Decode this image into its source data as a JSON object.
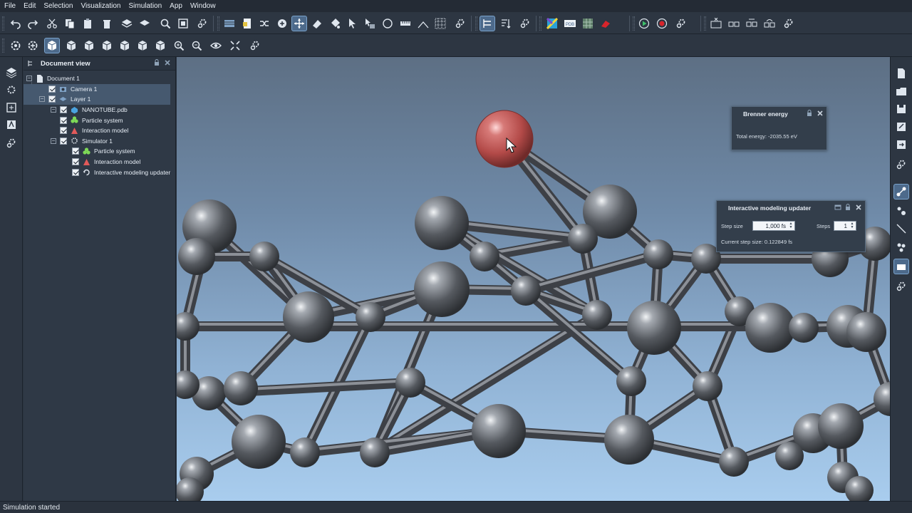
{
  "menubar": {
    "items": [
      "File",
      "Edit",
      "Selection",
      "Visualization",
      "Simulation",
      "App",
      "Window"
    ]
  },
  "toolbar_icons_row1": [
    "undo-icon",
    "redo-icon",
    "cut-icon",
    "copy-icon",
    "paste-icon",
    "delete-icon",
    "layer-icon",
    "layer-stack-icon",
    "zoom-icon",
    "fit-view-icon",
    "settings-icon",
    "grid-icon",
    "sheet-icon",
    "shuffle-icon",
    "add-atom-icon",
    "move-icon",
    "eraser-icon",
    "paint-icon",
    "select-icon",
    "select-box-icon",
    "lasso-icon",
    "ruler-icon",
    "angle-icon",
    "mesh-icon",
    "settings-icon",
    "hierarchy-icon",
    "sort-icon",
    "settings-icon",
    "color-icon",
    "pdb-icon",
    "texture-icon",
    "render-icon",
    "play-icon",
    "record-icon",
    "settings-icon",
    "close-window-icon",
    "split-icon",
    "tile-icon",
    "cascade-icon",
    "settings-icon"
  ],
  "toolbar_icons_row2": [
    "rotate-camera-icon",
    "orbit-icon",
    "view-cube-icon",
    "view-front-icon",
    "view-back-icon",
    "view-left-icon",
    "view-right-icon",
    "view-top-icon",
    "view-bottom-icon",
    "zoom-in-icon",
    "zoom-out-icon",
    "eye-icon",
    "fit-all-icon",
    "settings-icon"
  ],
  "doc_view": {
    "title": "Document view",
    "tree": [
      {
        "label": "Document 1",
        "level": 0,
        "expander": true,
        "checkbox": false,
        "icon": "document-icon",
        "selected": false
      },
      {
        "label": "Camera 1",
        "level": 1,
        "expander": false,
        "checkbox": true,
        "icon": "camera-icon",
        "selected": true
      },
      {
        "label": "Layer 1",
        "level": 1,
        "expander": true,
        "checkbox": true,
        "icon": "layer-icon",
        "selected": true
      },
      {
        "label": "NANOTUBE.pdb",
        "level": 2,
        "expander": true,
        "checkbox": true,
        "icon": "molecule-icon",
        "selected": false
      },
      {
        "label": "Particle system",
        "level": 2,
        "expander": false,
        "checkbox": true,
        "icon": "particles-icon",
        "selected": false
      },
      {
        "label": "Interaction model",
        "level": 2,
        "expander": false,
        "checkbox": true,
        "icon": "interaction-icon",
        "selected": false
      },
      {
        "label": "Simulator 1",
        "level": 2,
        "expander": true,
        "checkbox": true,
        "icon": "simulator-icon",
        "selected": false
      },
      {
        "label": "Particle system",
        "level": 3,
        "expander": false,
        "checkbox": true,
        "icon": "particles-icon",
        "selected": false
      },
      {
        "label": "Interaction model",
        "level": 3,
        "expander": false,
        "checkbox": true,
        "icon": "interaction-icon",
        "selected": false
      },
      {
        "label": "Interactive modeling updater",
        "level": 3,
        "expander": false,
        "checkbox": true,
        "icon": "updater-icon",
        "selected": false
      }
    ]
  },
  "brenner_panel": {
    "title": "Brenner energy",
    "total_energy": "Total energy: -2035.55 eV"
  },
  "imu_panel": {
    "title": "Interactive modeling updater",
    "step_size_label": "Step size",
    "step_size_value": "1,000 fs",
    "steps_label": "Steps",
    "steps_value": "1",
    "current_step": "Current step size: 0.122849 fs"
  },
  "status": {
    "text": "Simulation started"
  },
  "colors": {
    "atom_grey": "#5a5f66",
    "atom_selected": "#b84a4a",
    "background_top": "#5d6f84",
    "background_bottom": "#a9cdee"
  }
}
